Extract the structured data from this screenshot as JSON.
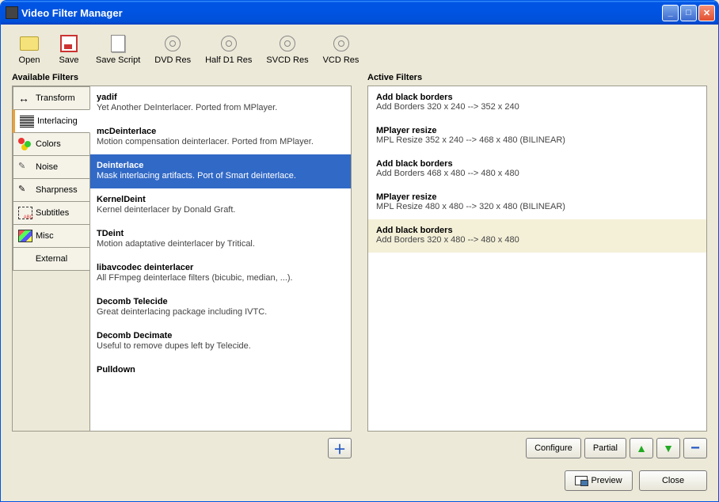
{
  "window": {
    "title": "Video Filter Manager"
  },
  "toolbar": [
    {
      "label": "Open",
      "icon": "open"
    },
    {
      "label": "Save",
      "icon": "save"
    },
    {
      "label": "Save Script",
      "icon": "script"
    },
    {
      "label": "DVD Res",
      "icon": "disc"
    },
    {
      "label": "Half D1 Res",
      "icon": "disc"
    },
    {
      "label": "SVCD Res",
      "icon": "disc"
    },
    {
      "label": "VCD Res",
      "icon": "disc"
    }
  ],
  "labels": {
    "available": "Available Filters",
    "active": "Active Filters",
    "configure": "Configure",
    "partial": "Partial",
    "preview": "Preview",
    "close": "Close"
  },
  "tabs": [
    {
      "label": "Transform",
      "icon": "transform",
      "active": false
    },
    {
      "label": "Interlacing",
      "icon": "interlace",
      "active": true
    },
    {
      "label": "Colors",
      "icon": "colors",
      "active": false
    },
    {
      "label": "Noise",
      "icon": "noise",
      "active": false
    },
    {
      "label": "Sharpness",
      "icon": "sharp",
      "active": false
    },
    {
      "label": "Subtitles",
      "icon": "subtitle",
      "active": false
    },
    {
      "label": "Misc",
      "icon": "misc",
      "active": false
    },
    {
      "label": "External",
      "icon": "",
      "active": false
    }
  ],
  "filters": [
    {
      "name": "yadif",
      "desc": "Yet Another DeInterlacer. Ported from MPlayer.",
      "selected": false
    },
    {
      "name": "mcDeinterlace",
      "desc": "Motion compensation deinterlacer. Ported from MPlayer.",
      "selected": false
    },
    {
      "name": "Deinterlace",
      "desc": "Mask interlacing artifacts. Port of Smart deinterlace.",
      "selected": true
    },
    {
      "name": "KernelDeint",
      "desc": "Kernel deinterlacer by Donald Graft.",
      "selected": false
    },
    {
      "name": "TDeint",
      "desc": "Motion adaptative deinterlacer by Tritical.",
      "selected": false
    },
    {
      "name": "libavcodec deinterlacer",
      "desc": "All FFmpeg deinterlace filters (bicubic, median, ...).",
      "selected": false
    },
    {
      "name": "Decomb Telecide",
      "desc": "Great deinterlacing package including IVTC.",
      "selected": false
    },
    {
      "name": "Decomb Decimate",
      "desc": "Useful to remove dupes left by Telecide.",
      "selected": false
    },
    {
      "name": "Pulldown",
      "desc": "",
      "selected": false
    }
  ],
  "active_filters": [
    {
      "name": "Add black borders",
      "desc": "Add Borders 320 x 240 --> 352 x 240",
      "selected": false
    },
    {
      "name": "MPlayer resize",
      "desc": "MPL Resize 352 x 240 --> 468 x 480 (BILINEAR)",
      "selected": false
    },
    {
      "name": "Add black borders",
      "desc": "Add Borders 468 x 480 --> 480 x 480",
      "selected": false
    },
    {
      "name": "MPlayer resize",
      "desc": "MPL Resize 480 x 480 --> 320 x 480 (BILINEAR)",
      "selected": false
    },
    {
      "name": "Add black borders",
      "desc": "Add Borders 320 x 480 --> 480 x 480",
      "selected": true
    }
  ]
}
